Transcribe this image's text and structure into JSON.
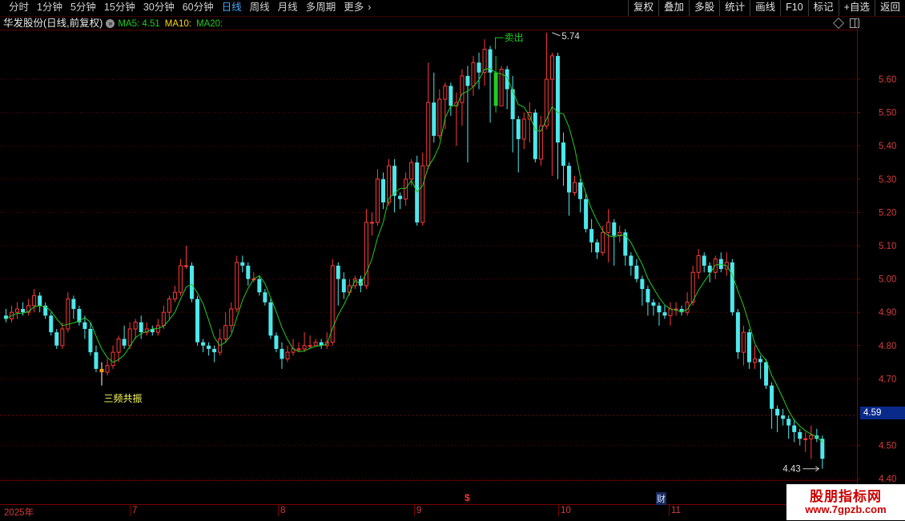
{
  "toolbar": {
    "periods": [
      "分时",
      "1分钟",
      "5分钟",
      "15分钟",
      "30分钟",
      "60分钟",
      "日线",
      "周线",
      "月线",
      "多周期",
      "更多"
    ],
    "active_period": "日线",
    "actions": [
      "复权",
      "叠加",
      "多股",
      "统计",
      "画线",
      "F10",
      "标记",
      "+自选",
      "返回"
    ]
  },
  "header": {
    "stock_title": "华发股份(日线,前复权)",
    "info_circle": "»",
    "ma5_label": "MA5: 4.51",
    "ma10_label": "MA10:",
    "ma20_label": "MA20:"
  },
  "colors": {
    "up": "#ff3a3a",
    "down": "#4de8ec",
    "ma5": "#ffffff",
    "ma10": "#ffd700",
    "ma20": "#22cc22",
    "signal_sell": "#22cc22",
    "signal_buy": "#ff9900",
    "axis": "#d23c3c"
  },
  "price_axis": {
    "ticks": [
      "5.60",
      "5.50",
      "5.40",
      "5.30",
      "5.20",
      "5.10",
      "5.00",
      "4.90",
      "4.80",
      "4.70",
      "4.50",
      "4.40"
    ],
    "current_price": "4.59"
  },
  "date_axis": {
    "labels": [
      "2025年",
      "7",
      "8",
      "9",
      "10",
      "11"
    ],
    "marker_s": "$",
    "marker_cai": "财"
  },
  "annotations": {
    "high_label": "5.74",
    "low_label": "4.43",
    "buy_signal_label": "三频共振",
    "sell_signal_label": "卖出"
  },
  "chart_data": {
    "type": "candlestick",
    "ylim": [
      4.4,
      5.74
    ],
    "candles": [
      [
        4.89,
        4.88,
        4.91,
        4.87
      ],
      [
        4.88,
        4.9,
        4.92,
        4.87
      ],
      [
        4.9,
        4.91,
        4.93,
        4.88
      ],
      [
        4.91,
        4.9,
        4.93,
        4.89
      ],
      [
        4.9,
        4.92,
        4.94,
        4.89
      ],
      [
        4.92,
        4.95,
        4.97,
        4.9
      ],
      [
        4.95,
        4.92,
        4.96,
        4.9
      ],
      [
        4.92,
        4.89,
        4.93,
        4.88
      ],
      [
        4.89,
        4.84,
        4.9,
        4.83
      ],
      [
        4.84,
        4.8,
        4.85,
        4.79
      ],
      [
        4.8,
        4.85,
        4.87,
        4.79
      ],
      [
        4.85,
        4.94,
        4.96,
        4.84
      ],
      [
        4.94,
        4.91,
        4.95,
        4.88
      ],
      [
        4.91,
        4.87,
        4.92,
        4.86
      ],
      [
        4.87,
        4.85,
        4.89,
        4.82
      ],
      [
        4.85,
        4.78,
        4.87,
        4.77
      ],
      [
        4.78,
        4.73,
        4.8,
        4.72
      ],
      [
        4.73,
        4.72,
        4.75,
        4.68
      ],
      [
        4.72,
        4.74,
        4.76,
        4.71
      ],
      [
        4.74,
        4.78,
        4.8,
        4.73
      ],
      [
        4.78,
        4.82,
        4.83,
        4.75
      ],
      [
        4.82,
        4.8,
        4.86,
        4.79
      ],
      [
        4.8,
        4.85,
        4.87,
        4.79
      ],
      [
        4.85,
        4.87,
        4.88,
        4.82
      ],
      [
        4.87,
        4.84,
        4.89,
        4.82
      ],
      [
        4.84,
        4.85,
        4.87,
        4.83
      ],
      [
        4.85,
        4.84,
        4.86,
        4.83
      ],
      [
        4.84,
        4.86,
        4.88,
        4.83
      ],
      [
        4.86,
        4.9,
        4.92,
        4.85
      ],
      [
        4.9,
        4.94,
        4.95,
        4.88
      ],
      [
        4.94,
        4.96,
        4.98,
        4.93
      ],
      [
        4.96,
        5.04,
        5.06,
        4.95
      ],
      [
        5.04,
        5.04,
        5.1,
        5.03
      ],
      [
        5.04,
        4.94,
        5.05,
        4.93
      ],
      [
        4.94,
        4.81,
        4.95,
        4.8
      ],
      [
        4.81,
        4.8,
        4.82,
        4.78
      ],
      [
        4.8,
        4.79,
        4.81,
        4.77
      ],
      [
        4.79,
        4.78,
        4.8,
        4.75
      ],
      [
        4.78,
        4.82,
        4.85,
        4.77
      ],
      [
        4.82,
        4.86,
        4.9,
        4.81
      ],
      [
        4.86,
        4.91,
        4.93,
        4.84
      ],
      [
        4.91,
        5.05,
        5.07,
        4.9
      ],
      [
        5.05,
        5.04,
        5.07,
        5.02
      ],
      [
        5.04,
        5.0,
        5.05,
        4.98
      ],
      [
        5.0,
        5.0,
        5.02,
        4.99
      ],
      [
        5.0,
        4.96,
        5.01,
        4.95
      ],
      [
        4.96,
        4.93,
        4.97,
        4.92
      ],
      [
        4.93,
        4.83,
        4.94,
        4.82
      ],
      [
        4.83,
        4.79,
        4.84,
        4.78
      ],
      [
        4.79,
        4.76,
        4.81,
        4.73
      ],
      [
        4.76,
        4.78,
        4.8,
        4.75
      ],
      [
        4.78,
        4.79,
        4.82,
        4.77
      ],
      [
        4.79,
        4.79,
        4.81,
        4.78
      ],
      [
        4.79,
        4.8,
        4.84,
        4.78
      ],
      [
        4.8,
        4.8,
        4.83,
        4.79
      ],
      [
        4.8,
        4.81,
        4.82,
        4.8
      ],
      [
        4.81,
        4.8,
        4.82,
        4.79
      ],
      [
        4.8,
        4.81,
        4.84,
        4.79
      ],
      [
        4.81,
        5.04,
        5.06,
        4.8
      ],
      [
        5.04,
        5.0,
        5.05,
        4.92
      ],
      [
        5.0,
        4.96,
        5.02,
        4.94
      ],
      [
        4.96,
        4.98,
        5.0,
        4.95
      ],
      [
        4.98,
        5.0,
        5.01,
        4.97
      ],
      [
        5.0,
        4.98,
        5.01,
        4.96
      ],
      [
        4.98,
        5.17,
        5.21,
        4.97
      ],
      [
        5.17,
        5.17,
        5.2,
        5.13
      ],
      [
        5.17,
        5.3,
        5.33,
        5.16
      ],
      [
        5.3,
        5.23,
        5.32,
        5.21
      ],
      [
        5.23,
        5.34,
        5.36,
        5.22
      ],
      [
        5.34,
        5.25,
        5.36,
        5.2
      ],
      [
        5.25,
        5.24,
        5.26,
        5.21
      ],
      [
        5.24,
        5.3,
        5.32,
        5.22
      ],
      [
        5.3,
        5.35,
        5.36,
        5.28
      ],
      [
        5.35,
        5.17,
        5.37,
        5.16
      ],
      [
        5.17,
        5.34,
        5.38,
        5.16
      ],
      [
        5.34,
        5.53,
        5.65,
        5.33
      ],
      [
        5.53,
        5.43,
        5.62,
        5.41
      ],
      [
        5.43,
        5.54,
        5.57,
        5.42
      ],
      [
        5.54,
        5.58,
        5.59,
        5.45
      ],
      [
        5.58,
        5.52,
        5.59,
        5.49
      ],
      [
        5.52,
        5.53,
        5.56,
        5.4
      ],
      [
        5.53,
        5.61,
        5.63,
        5.46
      ],
      [
        5.61,
        5.58,
        5.64,
        5.35
      ],
      [
        5.58,
        5.65,
        5.67,
        5.55
      ],
      [
        5.65,
        5.62,
        5.68,
        5.57
      ],
      [
        5.62,
        5.69,
        5.72,
        5.58
      ],
      [
        5.69,
        5.62,
        5.7,
        5.47
      ],
      [
        5.62,
        5.52,
        5.67,
        5.5
      ],
      [
        5.52,
        5.63,
        5.64,
        5.52
      ],
      [
        5.63,
        5.57,
        5.64,
        5.51
      ],
      [
        5.57,
        5.48,
        5.61,
        5.38
      ],
      [
        5.48,
        5.42,
        5.49,
        5.32
      ],
      [
        5.42,
        5.48,
        5.5,
        5.39
      ],
      [
        5.48,
        5.5,
        5.53,
        5.41
      ],
      [
        5.5,
        5.36,
        5.51,
        5.35
      ],
      [
        5.36,
        5.46,
        5.49,
        5.34
      ],
      [
        5.46,
        5.6,
        5.74,
        5.45
      ],
      [
        5.6,
        5.67,
        5.68,
        5.31
      ],
      [
        5.67,
        5.41,
        5.68,
        5.3
      ],
      [
        5.41,
        5.34,
        5.44,
        5.28
      ],
      [
        5.34,
        5.26,
        5.35,
        5.19
      ],
      [
        5.26,
        5.29,
        5.31,
        5.25
      ],
      [
        5.29,
        5.24,
        5.3,
        5.2
      ],
      [
        5.24,
        5.15,
        5.26,
        5.14
      ],
      [
        5.15,
        5.11,
        5.18,
        5.08
      ],
      [
        5.11,
        5.08,
        5.12,
        5.06
      ],
      [
        5.08,
        5.14,
        5.16,
        5.07
      ],
      [
        5.14,
        5.17,
        5.21,
        5.05
      ],
      [
        5.17,
        5.13,
        5.18,
        5.04
      ],
      [
        5.13,
        5.14,
        5.16,
        5.11
      ],
      [
        5.14,
        5.07,
        5.15,
        5.04
      ],
      [
        5.07,
        5.04,
        5.08,
        5.01
      ],
      [
        5.04,
        5.0,
        5.06,
        4.99
      ],
      [
        5.0,
        4.97,
        5.01,
        4.92
      ],
      [
        4.97,
        4.93,
        4.98,
        4.89
      ],
      [
        4.93,
        4.92,
        4.94,
        4.89
      ],
      [
        4.92,
        4.9,
        4.93,
        4.86
      ],
      [
        4.9,
        4.89,
        4.92,
        4.88
      ],
      [
        4.89,
        4.91,
        4.93,
        4.86
      ],
      [
        4.91,
        4.91,
        4.93,
        4.89
      ],
      [
        4.91,
        4.9,
        4.92,
        4.89
      ],
      [
        4.9,
        4.93,
        4.96,
        4.89
      ],
      [
        4.93,
        5.02,
        5.04,
        4.92
      ],
      [
        5.02,
        5.07,
        5.09,
        5.0
      ],
      [
        5.07,
        5.04,
        5.08,
        5.02
      ],
      [
        5.04,
        5.02,
        5.05,
        4.99
      ],
      [
        5.02,
        5.06,
        5.07,
        5.0
      ],
      [
        5.06,
        5.03,
        5.08,
        5.02
      ],
      [
        5.03,
        5.05,
        5.08,
        5.01
      ],
      [
        5.05,
        4.9,
        5.06,
        4.89
      ],
      [
        4.9,
        4.78,
        4.91,
        4.76
      ],
      [
        4.78,
        4.84,
        4.86,
        4.74
      ],
      [
        4.84,
        4.75,
        4.85,
        4.73
      ],
      [
        4.75,
        4.76,
        4.8,
        4.73
      ],
      [
        4.76,
        4.75,
        4.77,
        4.7
      ],
      [
        4.75,
        4.68,
        4.76,
        4.67
      ],
      [
        4.68,
        4.61,
        4.69,
        4.55
      ],
      [
        4.61,
        4.59,
        4.62,
        4.54
      ],
      [
        4.59,
        4.58,
        4.61,
        4.56
      ],
      [
        4.58,
        4.56,
        4.59,
        4.52
      ],
      [
        4.56,
        4.54,
        4.58,
        4.51
      ],
      [
        4.54,
        4.52,
        4.55,
        4.5
      ],
      [
        4.52,
        4.52,
        4.54,
        4.48
      ],
      [
        4.52,
        4.53,
        4.56,
        4.46
      ],
      [
        4.53,
        4.52,
        4.55,
        4.51
      ],
      [
        4.52,
        4.46,
        4.53,
        4.43
      ]
    ]
  }
}
